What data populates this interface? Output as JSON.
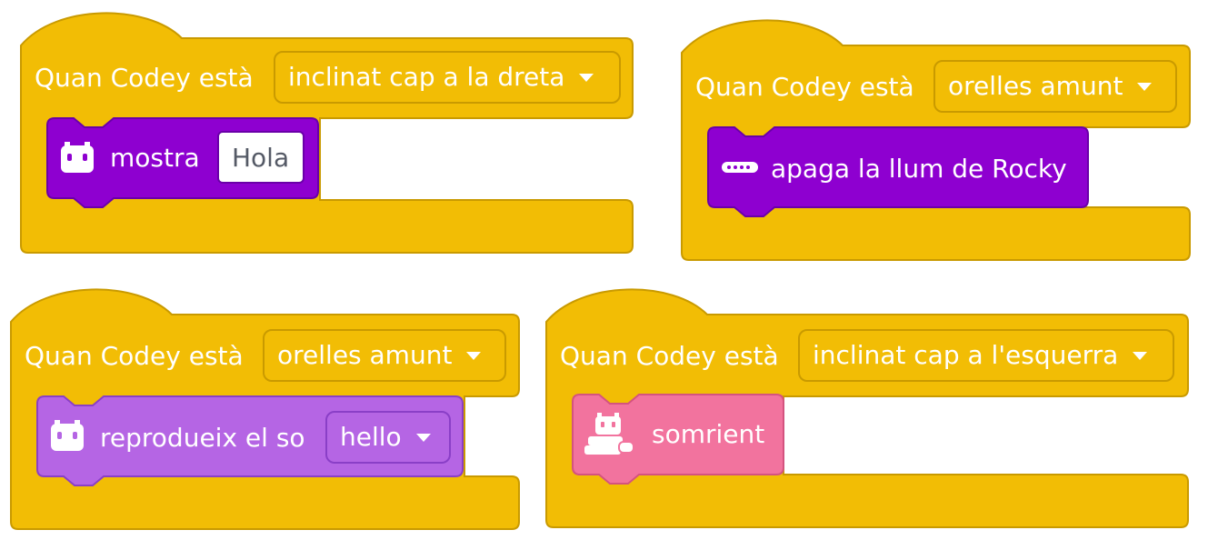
{
  "colors": {
    "events_yellow": "#f2bd05",
    "events_border": "#c99a00",
    "looks_purple": "#8e00d0",
    "sound_purple": "#b565e4",
    "emotion_pink": "#f2739e"
  },
  "blocks": [
    {
      "hat_label": "Quan Codey està",
      "dropdown_value": "inclinat cap a la dreta",
      "stack": {
        "icon": "codey-robot-icon",
        "label": "mostra",
        "input_value": "Hola"
      }
    },
    {
      "hat_label": "Quan Codey està",
      "dropdown_value": "orelles amunt",
      "stack": {
        "icon": "rocky-light-sensor-icon",
        "label": "apaga la llum de Rocky"
      }
    },
    {
      "hat_label": "Quan Codey està",
      "dropdown_value": "orelles amunt",
      "stack": {
        "icon": "codey-robot-icon",
        "label": "reprodueix el so",
        "dropdown_value": "hello"
      }
    },
    {
      "hat_label": "Quan Codey està",
      "dropdown_value": "inclinat cap a l'esquerra",
      "stack": {
        "icon": "codey-rocky-icon",
        "label": "somrient"
      }
    }
  ]
}
